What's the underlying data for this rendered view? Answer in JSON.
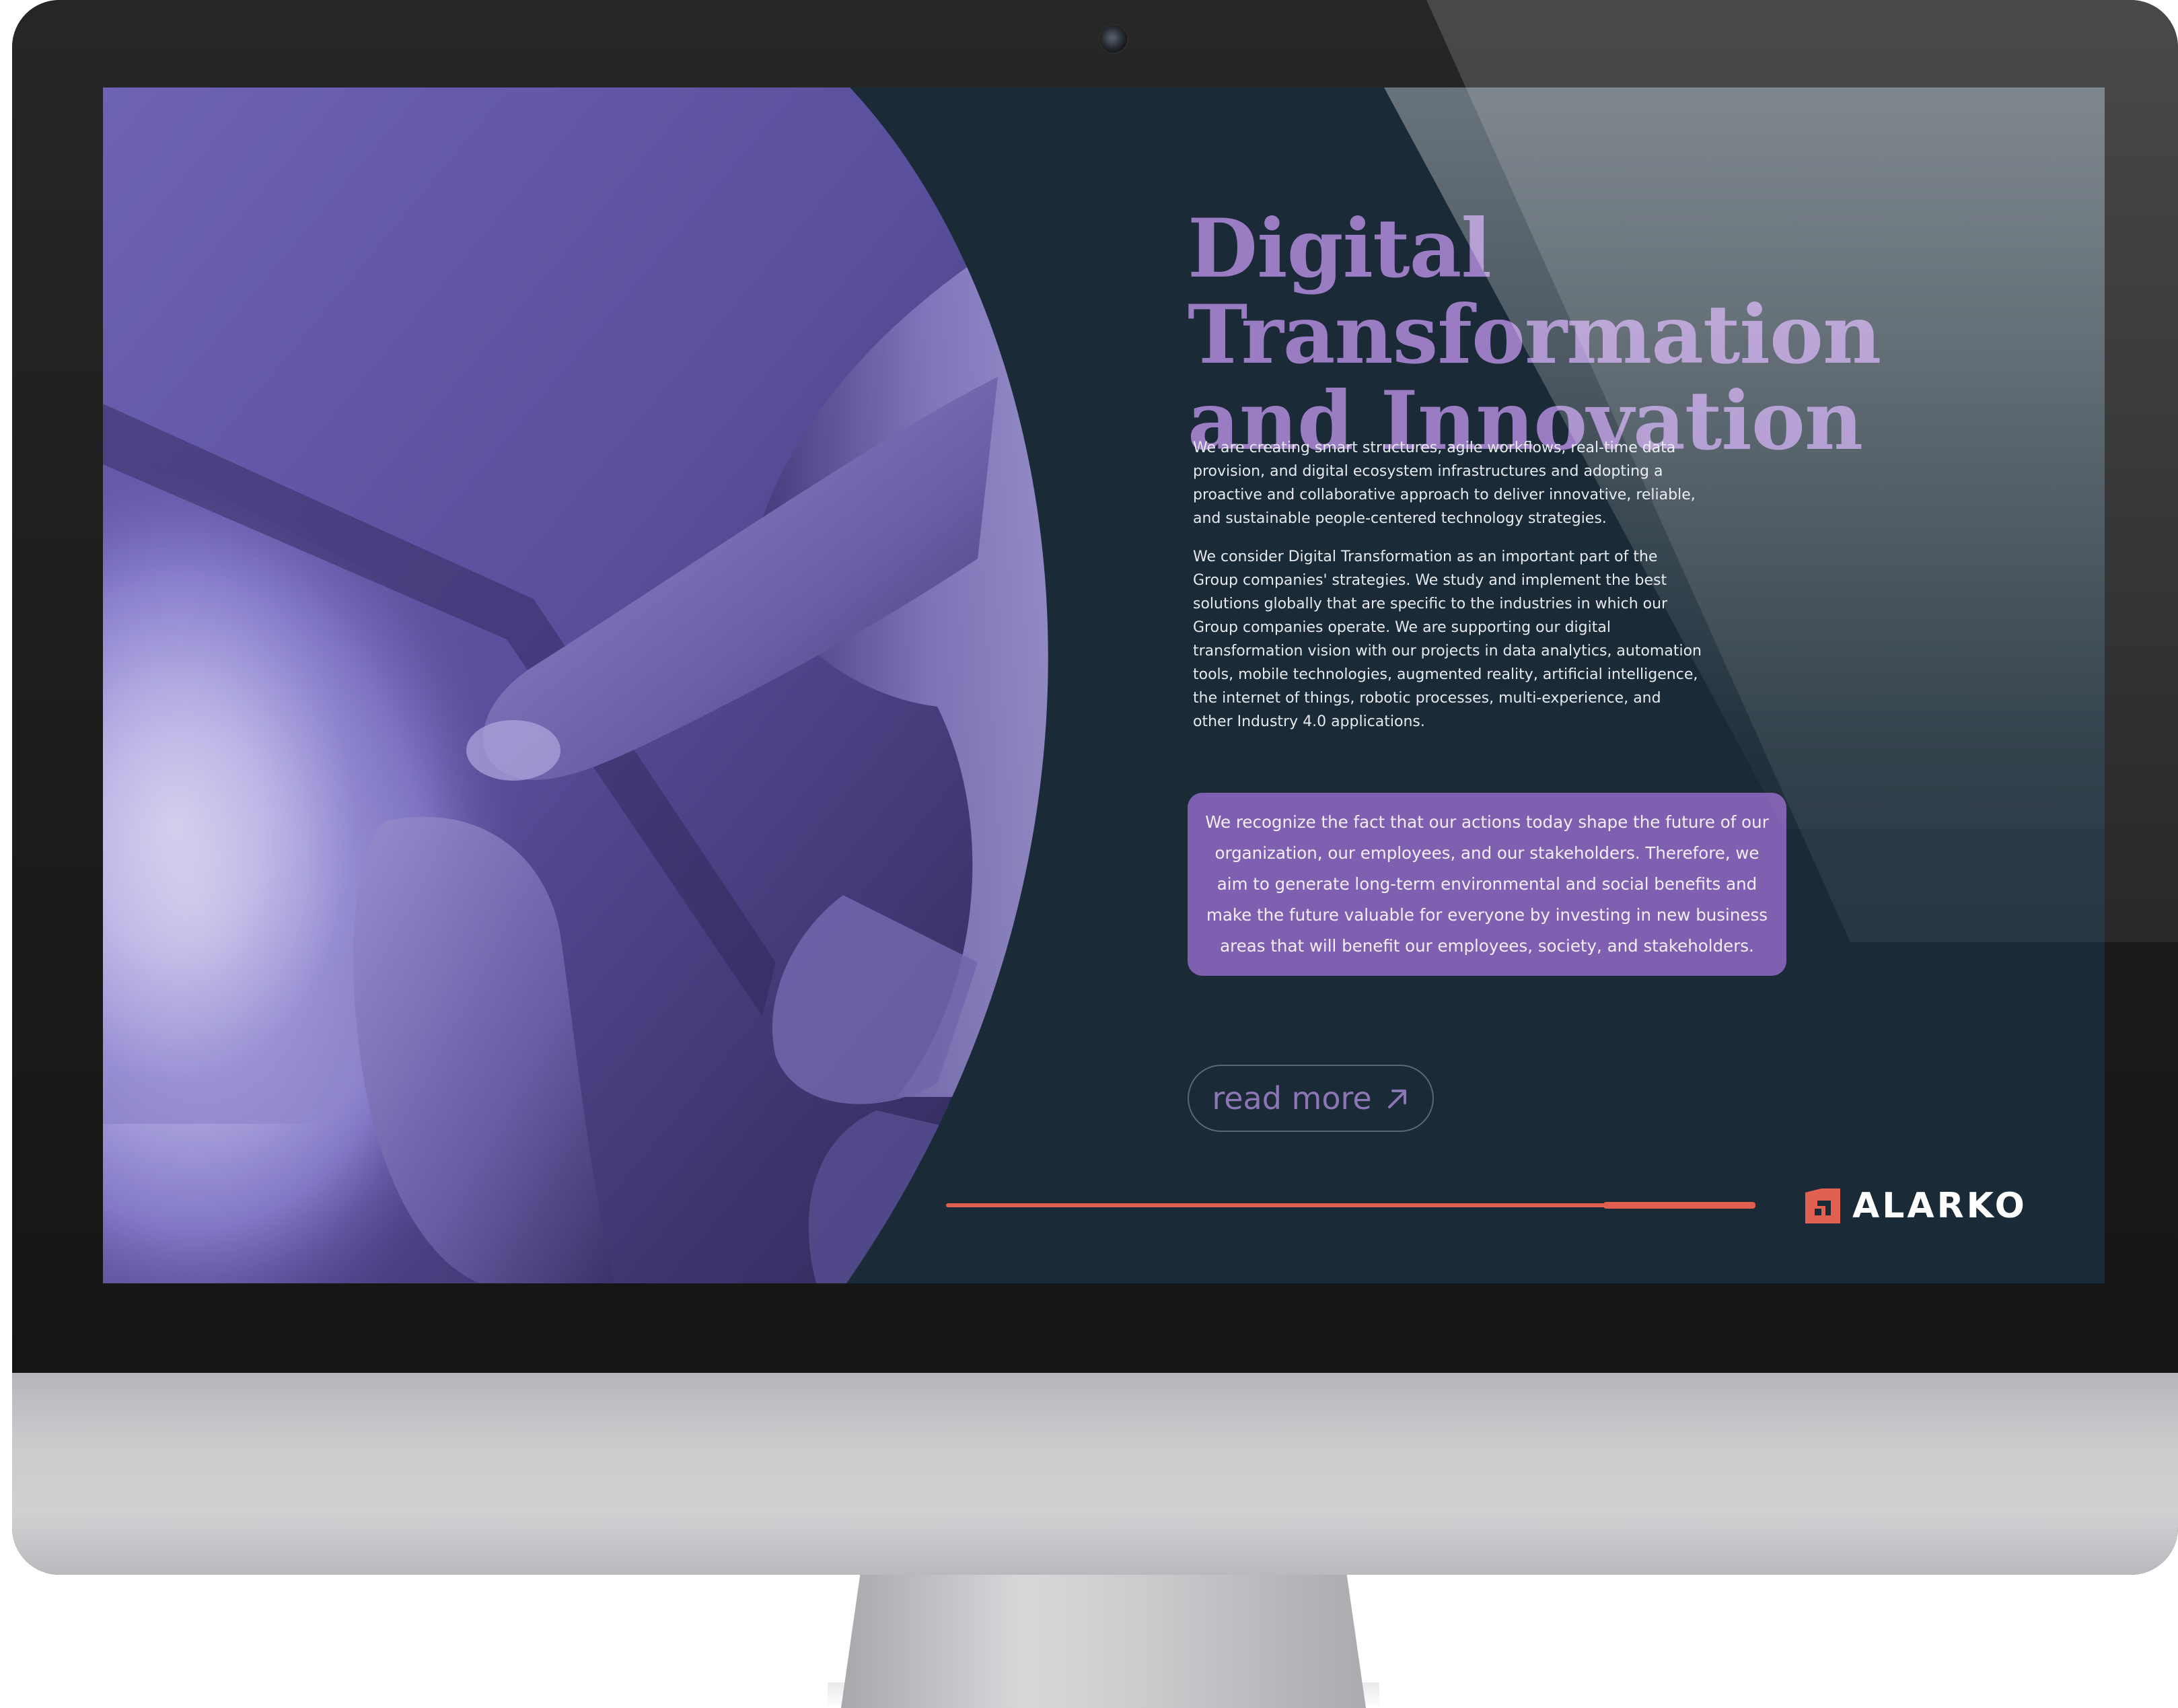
{
  "colors": {
    "screen_background": "#1a2a36",
    "headline": "#9a7cc3",
    "callout_background": "#7f5fb0",
    "accent_line": "#e2604f",
    "logo_mark": "#e2604f"
  },
  "hero": {
    "title_line1": "Digital Transformation",
    "title_line2": "and Innovation",
    "paragraph_1": "We are creating smart structures, agile workflows, real-time data provision, and digital ecosystem infrastructures and adopting a proactive and collaborative approach to deliver innovative, reliable, and sustainable people-centered technology strategies.",
    "paragraph_2": "We consider Digital Transformation as an important part of the Group companies' strategies. We study and implement the best solutions globally that are specific to the industries in which our Group companies operate. We are supporting our digital transformation vision with our projects in data analytics, automation tools, mobile technologies, augmented reality, artificial intelligence, the internet of things, robotic processes, multi-experience, and other Industry 4.0 applications.",
    "callout": "We recognize the fact that our actions today shape the future of our organization, our employees, and our stakeholders. Therefore, we aim to generate long-term environmental and social benefits and make the future valuable for everyone by investing in new business areas that will benefit our employees, society, and stakeholders.",
    "read_more_label": "read more",
    "read_more_icon": "arrow-up-right-icon"
  },
  "progress": {
    "fraction_highlighted": 0.19
  },
  "brand": {
    "logo_text": "ALARKO",
    "logo_icon": "alarko-logo-mark"
  }
}
